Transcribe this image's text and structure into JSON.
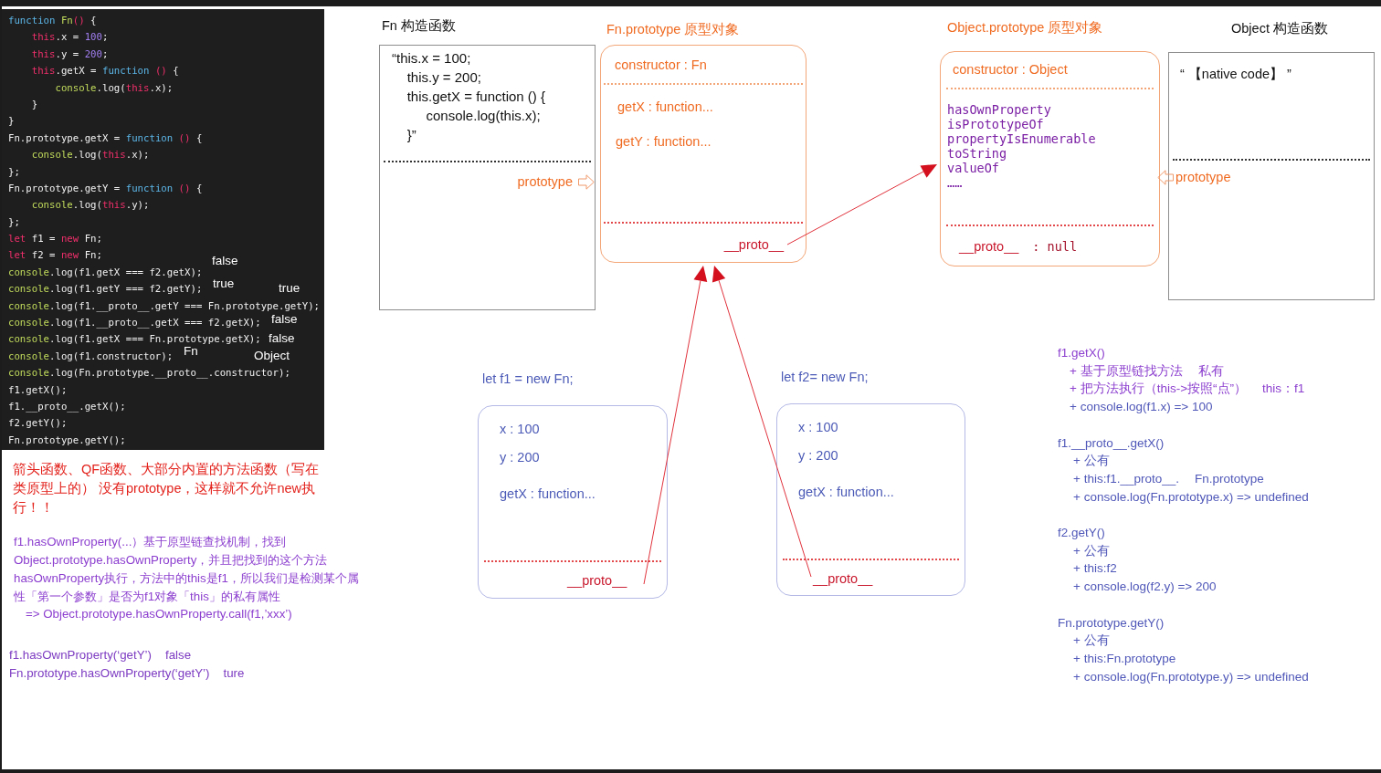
{
  "code_editor": {
    "lines": [
      {
        "tokens": [
          {
            "kind": "keyword",
            "text": "function"
          },
          {
            "kind": "builtin",
            "text": " Fn"
          },
          {
            "kind": "special",
            "text": "()"
          },
          {
            "kind": "plain",
            "text": " {"
          }
        ]
      },
      {
        "tokens": [
          {
            "kind": "special",
            "text": "    this"
          },
          {
            "kind": "plain",
            "text": ".x = "
          },
          {
            "kind": "number",
            "text": "100"
          },
          {
            "kind": "plain",
            "text": ";"
          }
        ]
      },
      {
        "tokens": [
          {
            "kind": "special",
            "text": "    this"
          },
          {
            "kind": "plain",
            "text": ".y = "
          },
          {
            "kind": "number",
            "text": "200"
          },
          {
            "kind": "plain",
            "text": ";"
          }
        ]
      },
      {
        "tokens": [
          {
            "kind": "special",
            "text": "    this"
          },
          {
            "kind": "plain",
            "text": ".getX = "
          },
          {
            "kind": "keyword",
            "text": "function"
          },
          {
            "kind": "special",
            "text": " ()"
          },
          {
            "kind": "plain",
            "text": " {"
          }
        ]
      },
      {
        "tokens": [
          {
            "kind": "builtin",
            "text": "        console"
          },
          {
            "kind": "plain",
            "text": ".log("
          },
          {
            "kind": "special",
            "text": "this"
          },
          {
            "kind": "plain",
            "text": ".x);"
          }
        ]
      },
      {
        "tokens": [
          {
            "kind": "plain",
            "text": "    }"
          }
        ]
      },
      {
        "tokens": [
          {
            "kind": "plain",
            "text": "}"
          }
        ]
      },
      {
        "tokens": [
          {
            "kind": "plain",
            "text": "Fn.prototype.getX = "
          },
          {
            "kind": "keyword",
            "text": "function"
          },
          {
            "kind": "special",
            "text": " ()"
          },
          {
            "kind": "plain",
            "text": " {"
          }
        ]
      },
      {
        "tokens": [
          {
            "kind": "builtin",
            "text": "    console"
          },
          {
            "kind": "plain",
            "text": ".log("
          },
          {
            "kind": "special",
            "text": "this"
          },
          {
            "kind": "plain",
            "text": ".x);"
          }
        ]
      },
      {
        "tokens": [
          {
            "kind": "plain",
            "text": "};"
          }
        ]
      },
      {
        "tokens": [
          {
            "kind": "plain",
            "text": "Fn.prototype.getY = "
          },
          {
            "kind": "keyword",
            "text": "function"
          },
          {
            "kind": "special",
            "text": " ()"
          },
          {
            "kind": "plain",
            "text": " {"
          }
        ]
      },
      {
        "tokens": [
          {
            "kind": "builtin",
            "text": "    console"
          },
          {
            "kind": "plain",
            "text": ".log("
          },
          {
            "kind": "special",
            "text": "this"
          },
          {
            "kind": "plain",
            "text": ".y);"
          }
        ]
      },
      {
        "tokens": [
          {
            "kind": "plain",
            "text": "};"
          }
        ]
      },
      {
        "tokens": [
          {
            "kind": "special",
            "text": "let"
          },
          {
            "kind": "plain",
            "text": " f1 = "
          },
          {
            "kind": "special",
            "text": "new"
          },
          {
            "kind": "plain",
            "text": " Fn;"
          }
        ]
      },
      {
        "tokens": [
          {
            "kind": "special",
            "text": "let"
          },
          {
            "kind": "plain",
            "text": " f2 = "
          },
          {
            "kind": "special",
            "text": "new"
          },
          {
            "kind": "plain",
            "text": " Fn;"
          }
        ]
      },
      {
        "tokens": [
          {
            "kind": "builtin",
            "text": "console"
          },
          {
            "kind": "plain",
            "text": ".log(f1.getX === f2.getX);"
          }
        ],
        "result": "false"
      },
      {
        "tokens": [
          {
            "kind": "builtin",
            "text": "console"
          },
          {
            "kind": "plain",
            "text": ".log(f1.getY === f2.getY);"
          }
        ],
        "result": "true"
      },
      {
        "tokens": [
          {
            "kind": "builtin",
            "text": "console"
          },
          {
            "kind": "plain",
            "text": ".log(f1.__proto__.getY === Fn.prototype.getY);"
          }
        ],
        "result": "true"
      },
      {
        "tokens": [
          {
            "kind": "builtin",
            "text": "console"
          },
          {
            "kind": "plain",
            "text": ".log(f1.__proto__.getX === f2.getX);"
          }
        ],
        "result": "false"
      },
      {
        "tokens": [
          {
            "kind": "builtin",
            "text": "console"
          },
          {
            "kind": "plain",
            "text": ".log(f1.getX === Fn.prototype.getX);"
          }
        ],
        "result": "false"
      },
      {
        "tokens": [
          {
            "kind": "builtin",
            "text": "console"
          },
          {
            "kind": "plain",
            "text": ".log(f1.constructor);"
          }
        ],
        "result": "Fn"
      },
      {
        "tokens": [
          {
            "kind": "builtin",
            "text": "console"
          },
          {
            "kind": "plain",
            "text": ".log(Fn.prototype.__proto__.constructor);"
          }
        ],
        "result": "Object"
      },
      {
        "tokens": [
          {
            "kind": "plain",
            "text": "f1.getX();"
          }
        ]
      },
      {
        "tokens": [
          {
            "kind": "plain",
            "text": "f1.__proto__.getX();"
          }
        ]
      },
      {
        "tokens": [
          {
            "kind": "plain",
            "text": "f2.getY();"
          }
        ]
      },
      {
        "tokens": [
          {
            "kind": "plain",
            "text": "Fn.prototype.getY();"
          }
        ]
      }
    ]
  },
  "left_notes": {
    "warning": {
      "lines": [
        "箭头函数、QF函数、大部分内置的方法函数（写在",
        "类原型上的） 没有prototype，这样就不允许new执",
        "行！！"
      ]
    },
    "explanation": {
      "lines": [
        "f1.hasOwnProperty(...）基于原型链查找机制，找到",
        "Object.prototype.hasOwnProperty，并且把找到的这个方法",
        "hasOwnProperty执行，方法中的this是f1，所以我们是检测某个属",
        "性「第一个参数」是否为f1对象「this」的私有属性"
      ],
      "example": "=> Object.prototype.hasOwnProperty.call(f1,’xxx’)"
    },
    "checks": [
      {
        "expression": "f1.hasOwnProperty(‘getY’)",
        "result": "false"
      },
      {
        "expression": "Fn.prototype.hasOwnProperty(‘getY’)",
        "result": "ture"
      }
    ]
  },
  "diagram": {
    "fn_constructor": {
      "title": "Fn 构造函数",
      "body_lines": [
        "“this.x = 100;",
        "    this.y = 200;",
        "    this.getX = function () {",
        "         console.log(this.x);",
        "    }”"
      ],
      "prototype_label": "prototype"
    },
    "fn_prototype": {
      "title": "Fn.prototype 原型对象",
      "constructor": "constructor : Fn",
      "members": [
        "getX : function...",
        "getY : function..."
      ],
      "proto_label": "__proto__"
    },
    "object_prototype": {
      "title": "Object.prototype 原型对象",
      "constructor": "constructor : Object",
      "methods": [
        "hasOwnProperty",
        "isPrototypeOf",
        "propertyIsEnumerable",
        "toString",
        "valueOf",
        "……"
      ],
      "proto_label": "__proto__",
      "proto_value": ": null"
    },
    "object_constructor": {
      "title": "Object 构造函数",
      "body": "“ 【native code】 ”",
      "prototype_label": "prototype"
    },
    "instances": [
      {
        "title": "let f1 = new Fn;",
        "members": [
          "x : 100",
          "y : 200",
          "getX : function..."
        ],
        "proto_label": "__proto__"
      },
      {
        "title": "let f2= new Fn;",
        "members": [
          "x : 100",
          "y : 200",
          "getX : function..."
        ],
        "proto_label": "__proto__"
      }
    ]
  },
  "call_notes": [
    {
      "title": {
        "text": "f1.getX()",
        "highlighted": true
      },
      "items": [
        {
          "parts": [
            "+ 基于原型链找方法",
            "私有"
          ],
          "highlighted": true
        },
        {
          "parts": [
            "+ 把方法执行（this->按照“点”）",
            "this：f1"
          ],
          "highlighted": true
        },
        {
          "parts": [
            "+ console.log(f1.x) => 100"
          ],
          "highlighted": false
        }
      ]
    },
    {
      "title": {
        "text": "f1.__proto__.getX()",
        "highlighted": false
      },
      "items": [
        {
          "parts": [
            "+ 公有"
          ],
          "highlighted": false
        },
        {
          "parts": [
            "+ this:f1.__proto__.",
            "Fn.prototype"
          ],
          "highlighted": false
        },
        {
          "parts": [
            "+ console.log(Fn.prototype.x) => undefined"
          ],
          "highlighted": false
        }
      ]
    },
    {
      "title": {
        "text": "f2.getY()",
        "highlighted": false
      },
      "items": [
        {
          "parts": [
            "+ 公有"
          ],
          "highlighted": false
        },
        {
          "parts": [
            "+ this:f2"
          ],
          "highlighted": false
        },
        {
          "parts": [
            "+ console.log(f2.y) => 200"
          ],
          "highlighted": false
        }
      ]
    },
    {
      "title": {
        "text": "Fn.prototype.getY()",
        "highlighted": false
      },
      "items": [
        {
          "parts": [
            "+ 公有"
          ],
          "highlighted": false
        },
        {
          "parts": [
            "+ this:Fn.prototype"
          ],
          "highlighted": false
        },
        {
          "parts": [
            "+ console.log(Fn.prototype.y) => undefined"
          ],
          "highlighted": false
        }
      ]
    }
  ]
}
